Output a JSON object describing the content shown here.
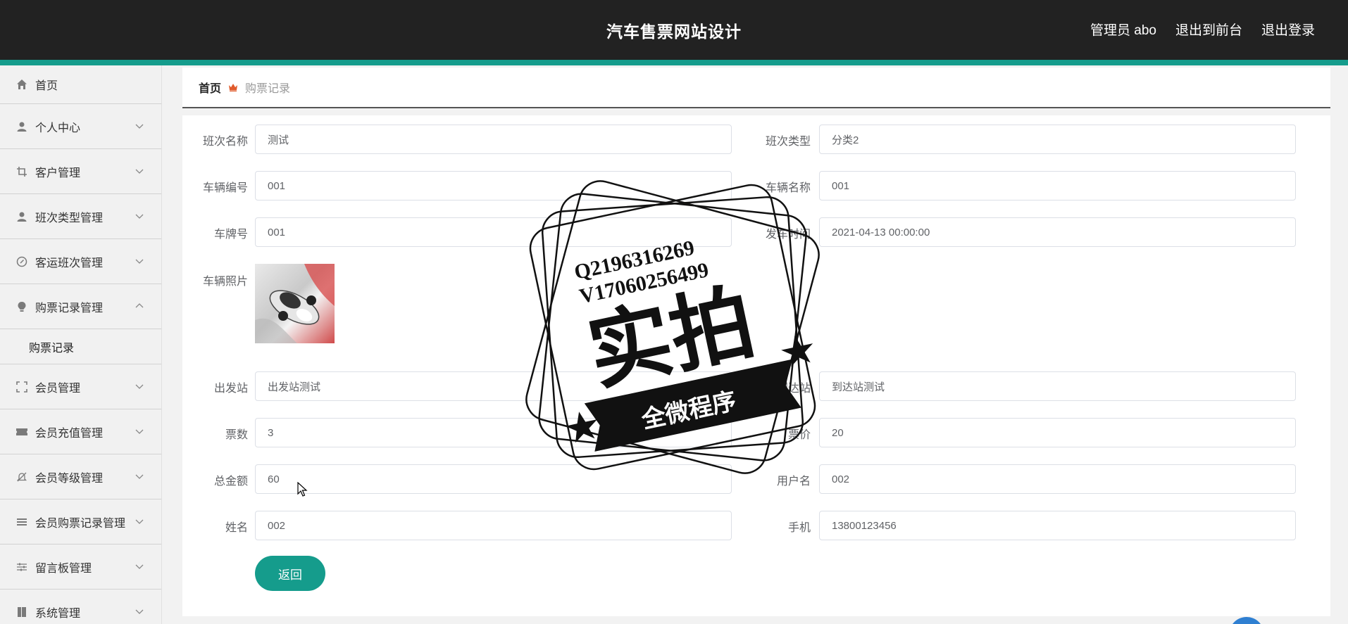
{
  "header": {
    "title": "汽车售票网站设计",
    "admin_label": "管理员 abo",
    "to_front": "退出到前台",
    "logout": "退出登录"
  },
  "sidebar": {
    "items": [
      {
        "label": "首页",
        "icon": "home-icon"
      },
      {
        "label": "个人中心",
        "icon": "user-icon"
      },
      {
        "label": "客户管理",
        "icon": "crop-icon"
      },
      {
        "label": "班次类型管理",
        "icon": "user-icon"
      },
      {
        "label": "客运班次管理",
        "icon": "compass-icon"
      },
      {
        "label": "购票记录管理",
        "icon": "bulb-icon",
        "expanded": true,
        "children": [
          {
            "label": "购票记录"
          }
        ]
      },
      {
        "label": "会员管理",
        "icon": "fullscreen-icon"
      },
      {
        "label": "会员充值管理",
        "icon": "ticket-icon"
      },
      {
        "label": "会员等级管理",
        "icon": "bell-off-icon"
      },
      {
        "label": "会员购票记录管理",
        "icon": "menu-icon"
      },
      {
        "label": "留言板管理",
        "icon": "sliders-icon"
      },
      {
        "label": "系统管理",
        "icon": "book-icon"
      }
    ]
  },
  "breadcrumb": {
    "home": "首页",
    "current": "购票记录"
  },
  "form": {
    "banci_name": {
      "label": "班次名称",
      "value": "测试"
    },
    "banci_type": {
      "label": "班次类型",
      "value": "分类2"
    },
    "vehicle_no": {
      "label": "车辆编号",
      "value": "001"
    },
    "vehicle_name": {
      "label": "车辆名称",
      "value": "001"
    },
    "plate_no": {
      "label": "车牌号",
      "value": "001"
    },
    "depart_time": {
      "label": "发车时间",
      "value": "2021-04-13 00:00:00"
    },
    "vehicle_photo": {
      "label": "车辆照片"
    },
    "from_station": {
      "label": "出发站",
      "value": "出发站测试"
    },
    "to_station": {
      "label": "到达站",
      "value": "到达站测试"
    },
    "ticket_count": {
      "label": "票数",
      "value": "3"
    },
    "ticket_price": {
      "label": "票价",
      "value": "20"
    },
    "total_amount": {
      "label": "总金额",
      "value": "60"
    },
    "username": {
      "label": "用户名",
      "value": "002"
    },
    "name": {
      "label": "姓名",
      "value": "002"
    },
    "phone": {
      "label": "手机",
      "value": "13800123456"
    },
    "back_button": "返回"
  },
  "watermark": {
    "line1": "Q2196316269",
    "line2": "V17060256499",
    "big": "实拍",
    "banner": "全微程序"
  },
  "colors": {
    "header_bg": "#222222",
    "accent": "#159c8c"
  }
}
